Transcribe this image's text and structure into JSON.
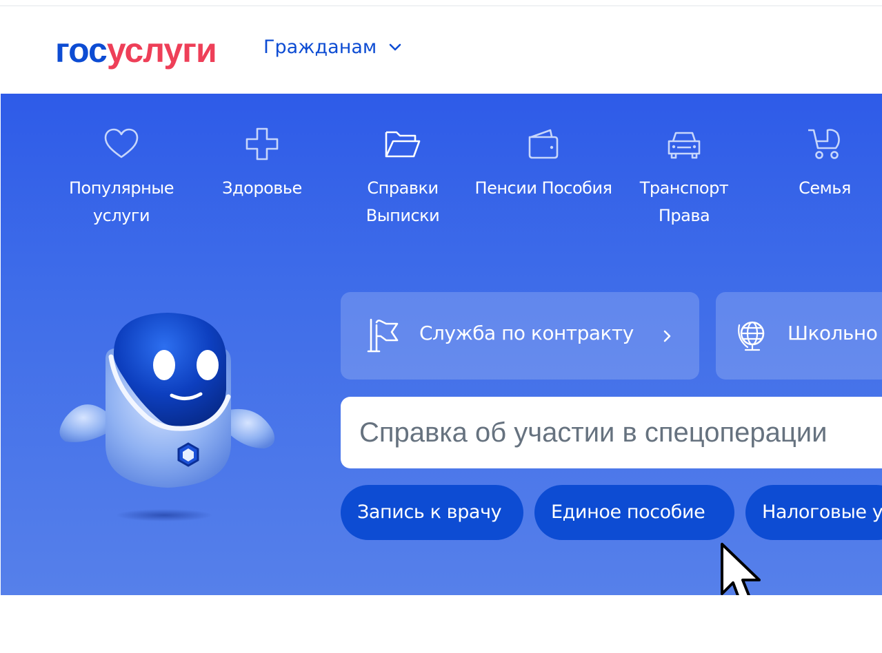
{
  "header": {
    "logo_part1": "гос",
    "logo_part2": "услуги",
    "nav_dropdown_label": "Гражданам"
  },
  "categories": [
    {
      "label": "Популярные услуги",
      "icon": "heart-icon"
    },
    {
      "label": "Здоровье",
      "icon": "health-cross-icon"
    },
    {
      "label": "Справки Выписки",
      "icon": "folder-icon"
    },
    {
      "label": "Пенсии Пособия",
      "icon": "wallet-icon"
    },
    {
      "label": "Транспорт Права",
      "icon": "car-icon"
    },
    {
      "label": "Семья",
      "icon": "stroller-icon"
    }
  ],
  "cards": [
    {
      "label": "Служба по контракту",
      "icon": "flag-icon"
    },
    {
      "label": "Школьно",
      "icon": "globe-icon"
    }
  ],
  "search": {
    "placeholder": "Справка об участии в спецоперации"
  },
  "quick_chips": [
    "Запись к врачу",
    "Единое пособие",
    "Налоговые у"
  ],
  "colors": {
    "brand_blue": "#0d4cd3",
    "brand_red": "#ee3f58",
    "hero_blue": "#2e5be8"
  }
}
